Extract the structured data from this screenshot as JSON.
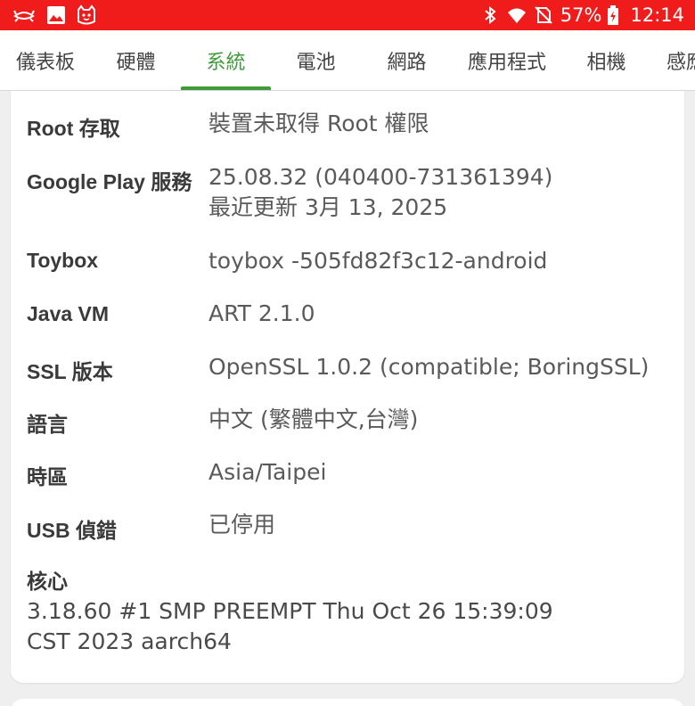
{
  "status_bar": {
    "battery_percent": "57%",
    "time": "12:14",
    "icons": [
      "crab-app-icon",
      "gallery-icon",
      "cat-app-icon",
      "bluetooth-icon",
      "wifi-icon",
      "no-sim-icon",
      "battery-charging-icon"
    ],
    "background_color": "#f01c1c"
  },
  "tabs": {
    "items": [
      "儀表板",
      "硬體",
      "系統",
      "電池",
      "網路",
      "應用程式",
      "相機",
      "感應器"
    ],
    "active_index": 2,
    "accent_color": "#3f9a3b"
  },
  "system_info": {
    "root": {
      "label": "Root 存取",
      "value": "裝置未取得 Root 權限"
    },
    "play_services": {
      "label": "Google Play 服務",
      "value_line1": "25.08.32 (040400-731361394)",
      "value_line2": "最近更新 3月 13, 2025"
    },
    "toybox": {
      "label": "Toybox",
      "value": "toybox -505fd82f3c12-android"
    },
    "java_vm": {
      "label": "Java VM",
      "value": "ART 2.1.0"
    },
    "ssl": {
      "label": "SSL 版本",
      "value": "OpenSSL 1.0.2 (compatible; BoringSSL)"
    },
    "language": {
      "label": "語言",
      "value": "中文 (繁體中文,台灣)"
    },
    "timezone": {
      "label": "時區",
      "value": "Asia/Taipei"
    },
    "usb_debug": {
      "label": "USB 偵錯",
      "value": "已停用"
    },
    "kernel": {
      "label": "核心",
      "value_line1": "3.18.60 #1 SMP PREEMPT Thu Oct 26 15:39:09",
      "value_line2": "CST 2023 aarch64"
    }
  }
}
